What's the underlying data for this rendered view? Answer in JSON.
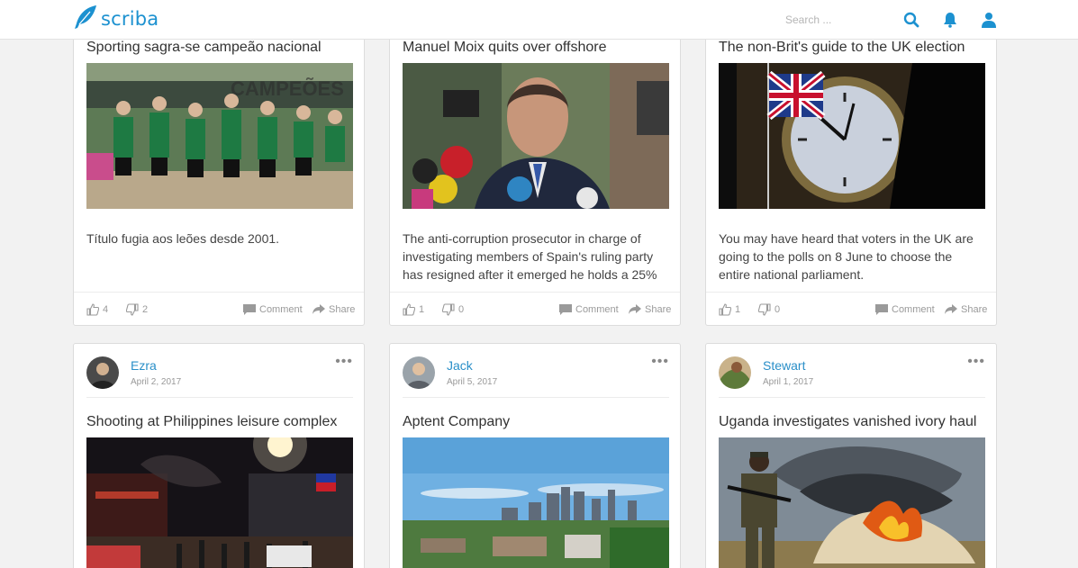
{
  "header": {
    "logo_text": "scriba",
    "search_placeholder": "Search ...",
    "icons": [
      "feather-logo-icon",
      "search-icon",
      "bell-icon",
      "user-icon"
    ],
    "accent_color": "#1c91d0"
  },
  "cards_top": [
    {
      "title": "Sporting sagra-se campeão nacional",
      "image": "football-team-celebration",
      "text": "Título fugia aos leões desde 2001.",
      "likes": "4",
      "dislikes": "2",
      "comment_label": "Comment",
      "share_label": "Share"
    },
    {
      "title": "Manuel Moix quits over offshore",
      "image": "man-with-microphones",
      "text": "The anti-corruption prosecutor in charge of investigating members of Spain's ruling party has resigned after it emerged he holds a 25%",
      "likes": "1",
      "dislikes": "0",
      "comment_label": "Comment",
      "share_label": "Share"
    },
    {
      "title": "The non-Brit's guide to the UK election",
      "image": "big-ben-union-jack",
      "text": "You may have heard that voters in the UK are going to the polls on 8 June to choose the entire national parliament.",
      "likes": "1",
      "dislikes": "0",
      "comment_label": "Comment",
      "share_label": "Share"
    }
  ],
  "cards_bottom": [
    {
      "author": "Ezra",
      "date": "April 2, 2017",
      "more": "•••",
      "title": "Shooting at Philippines leisure complex",
      "image": "night-street-scene"
    },
    {
      "author": "Jack",
      "date": "April 5, 2017",
      "more": "•••",
      "title": "Aptent Company",
      "image": "city-skyline"
    },
    {
      "author": "Stewart",
      "date": "April 1, 2017",
      "more": "•••",
      "title": "Uganda investigates vanished ivory haul",
      "image": "soldier-ivory-fire"
    }
  ]
}
